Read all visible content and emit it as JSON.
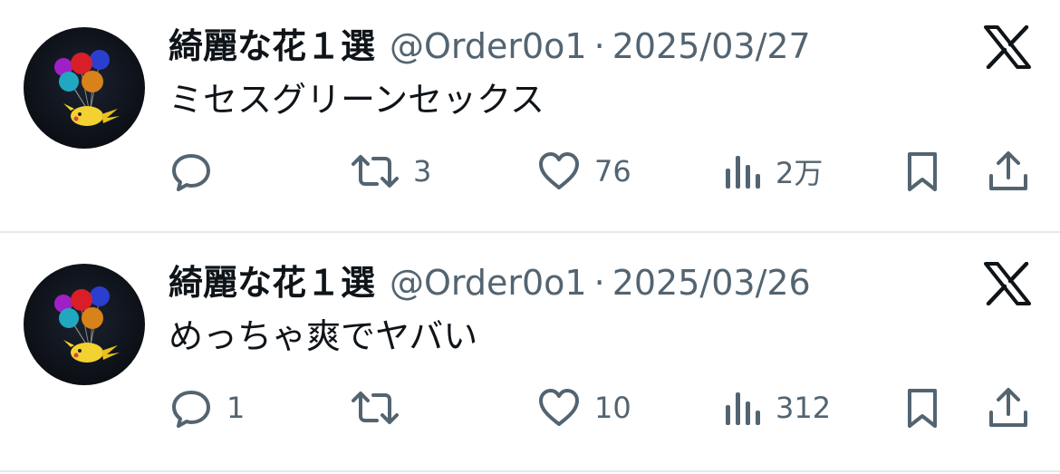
{
  "posts": [
    {
      "display_name": "綺麗な花１選",
      "handle": "@Order0o1",
      "separator": "·",
      "date": "2025/03/27",
      "text": "ミセスグリーンセックス",
      "replies": "",
      "retweets": "3",
      "likes": "76",
      "views": "2万",
      "avatar_icon": "pikachu-balloons-avatar",
      "platform_icon": "x-logo-icon"
    },
    {
      "display_name": "綺麗な花１選",
      "handle": "@Order0o1",
      "separator": "·",
      "date": "2025/03/26",
      "text": "めっちゃ爽でヤバい",
      "replies": "1",
      "retweets": "",
      "likes": "10",
      "views": "312",
      "avatar_icon": "pikachu-balloons-avatar",
      "platform_icon": "x-logo-icon"
    }
  ],
  "colors": {
    "text_primary": "#0f1419",
    "text_secondary": "#536471",
    "divider": "#e6e8eb",
    "background": "#ffffff"
  },
  "icons": {
    "reply": "speech-bubble-icon",
    "retweet": "retweet-arrows-icon",
    "like": "heart-icon",
    "views": "bar-chart-icon",
    "bookmark": "bookmark-icon",
    "share": "share-upload-icon"
  }
}
